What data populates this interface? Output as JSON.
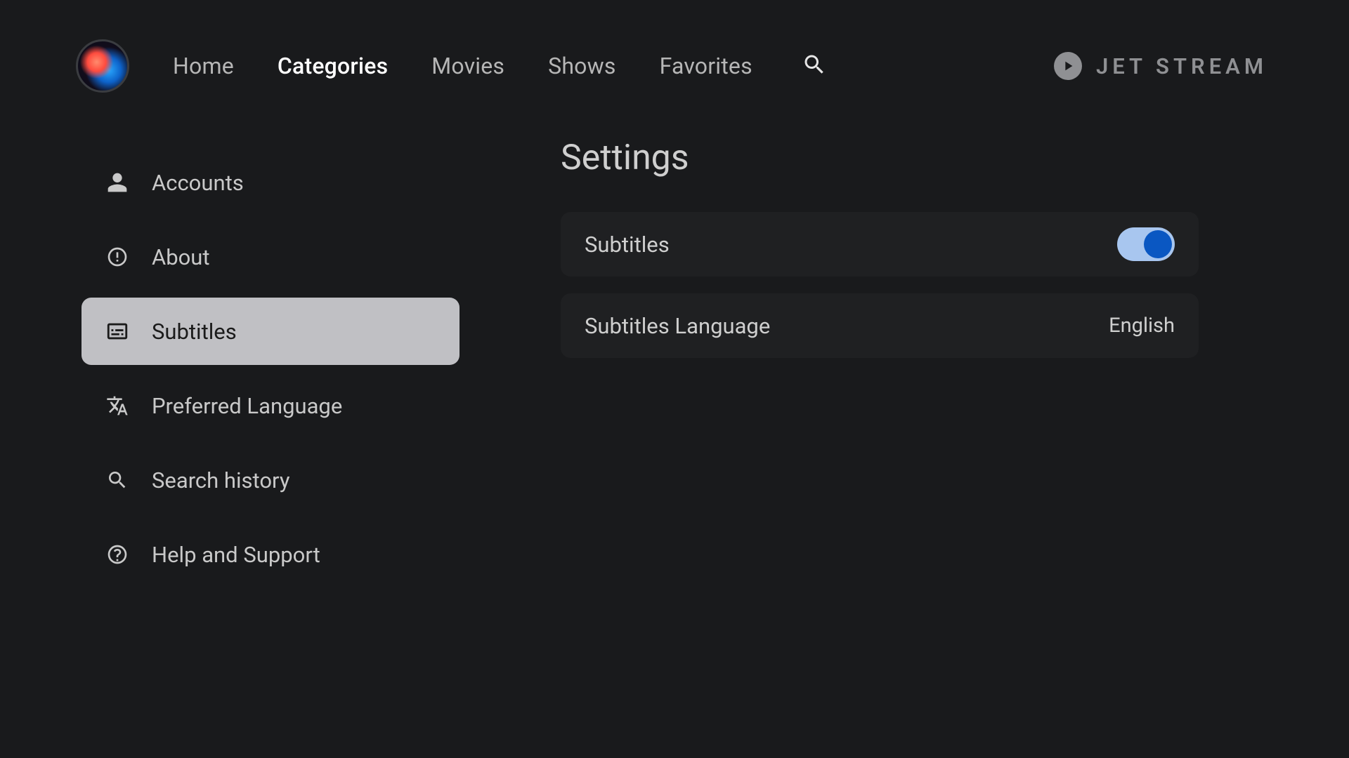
{
  "brand": {
    "name": "JET STREAM"
  },
  "nav": {
    "items": [
      {
        "label": "Home",
        "active": false
      },
      {
        "label": "Categories",
        "active": true
      },
      {
        "label": "Movies",
        "active": false
      },
      {
        "label": "Shows",
        "active": false
      },
      {
        "label": "Favorites",
        "active": false
      }
    ]
  },
  "sidebar": {
    "items": [
      {
        "icon": "person-icon",
        "label": "Accounts",
        "selected": false
      },
      {
        "icon": "info-icon",
        "label": "About",
        "selected": false
      },
      {
        "icon": "subtitles-icon",
        "label": "Subtitles",
        "selected": true
      },
      {
        "icon": "translate-icon",
        "label": "Preferred Language",
        "selected": false
      },
      {
        "icon": "search-icon",
        "label": "Search history",
        "selected": false
      },
      {
        "icon": "help-icon",
        "label": "Help and Support",
        "selected": false
      }
    ]
  },
  "main": {
    "title": "Settings",
    "rows": [
      {
        "kind": "toggle",
        "label": "Subtitles",
        "value_on": true
      },
      {
        "kind": "value",
        "label": "Subtitles Language",
        "value": "English"
      }
    ]
  }
}
